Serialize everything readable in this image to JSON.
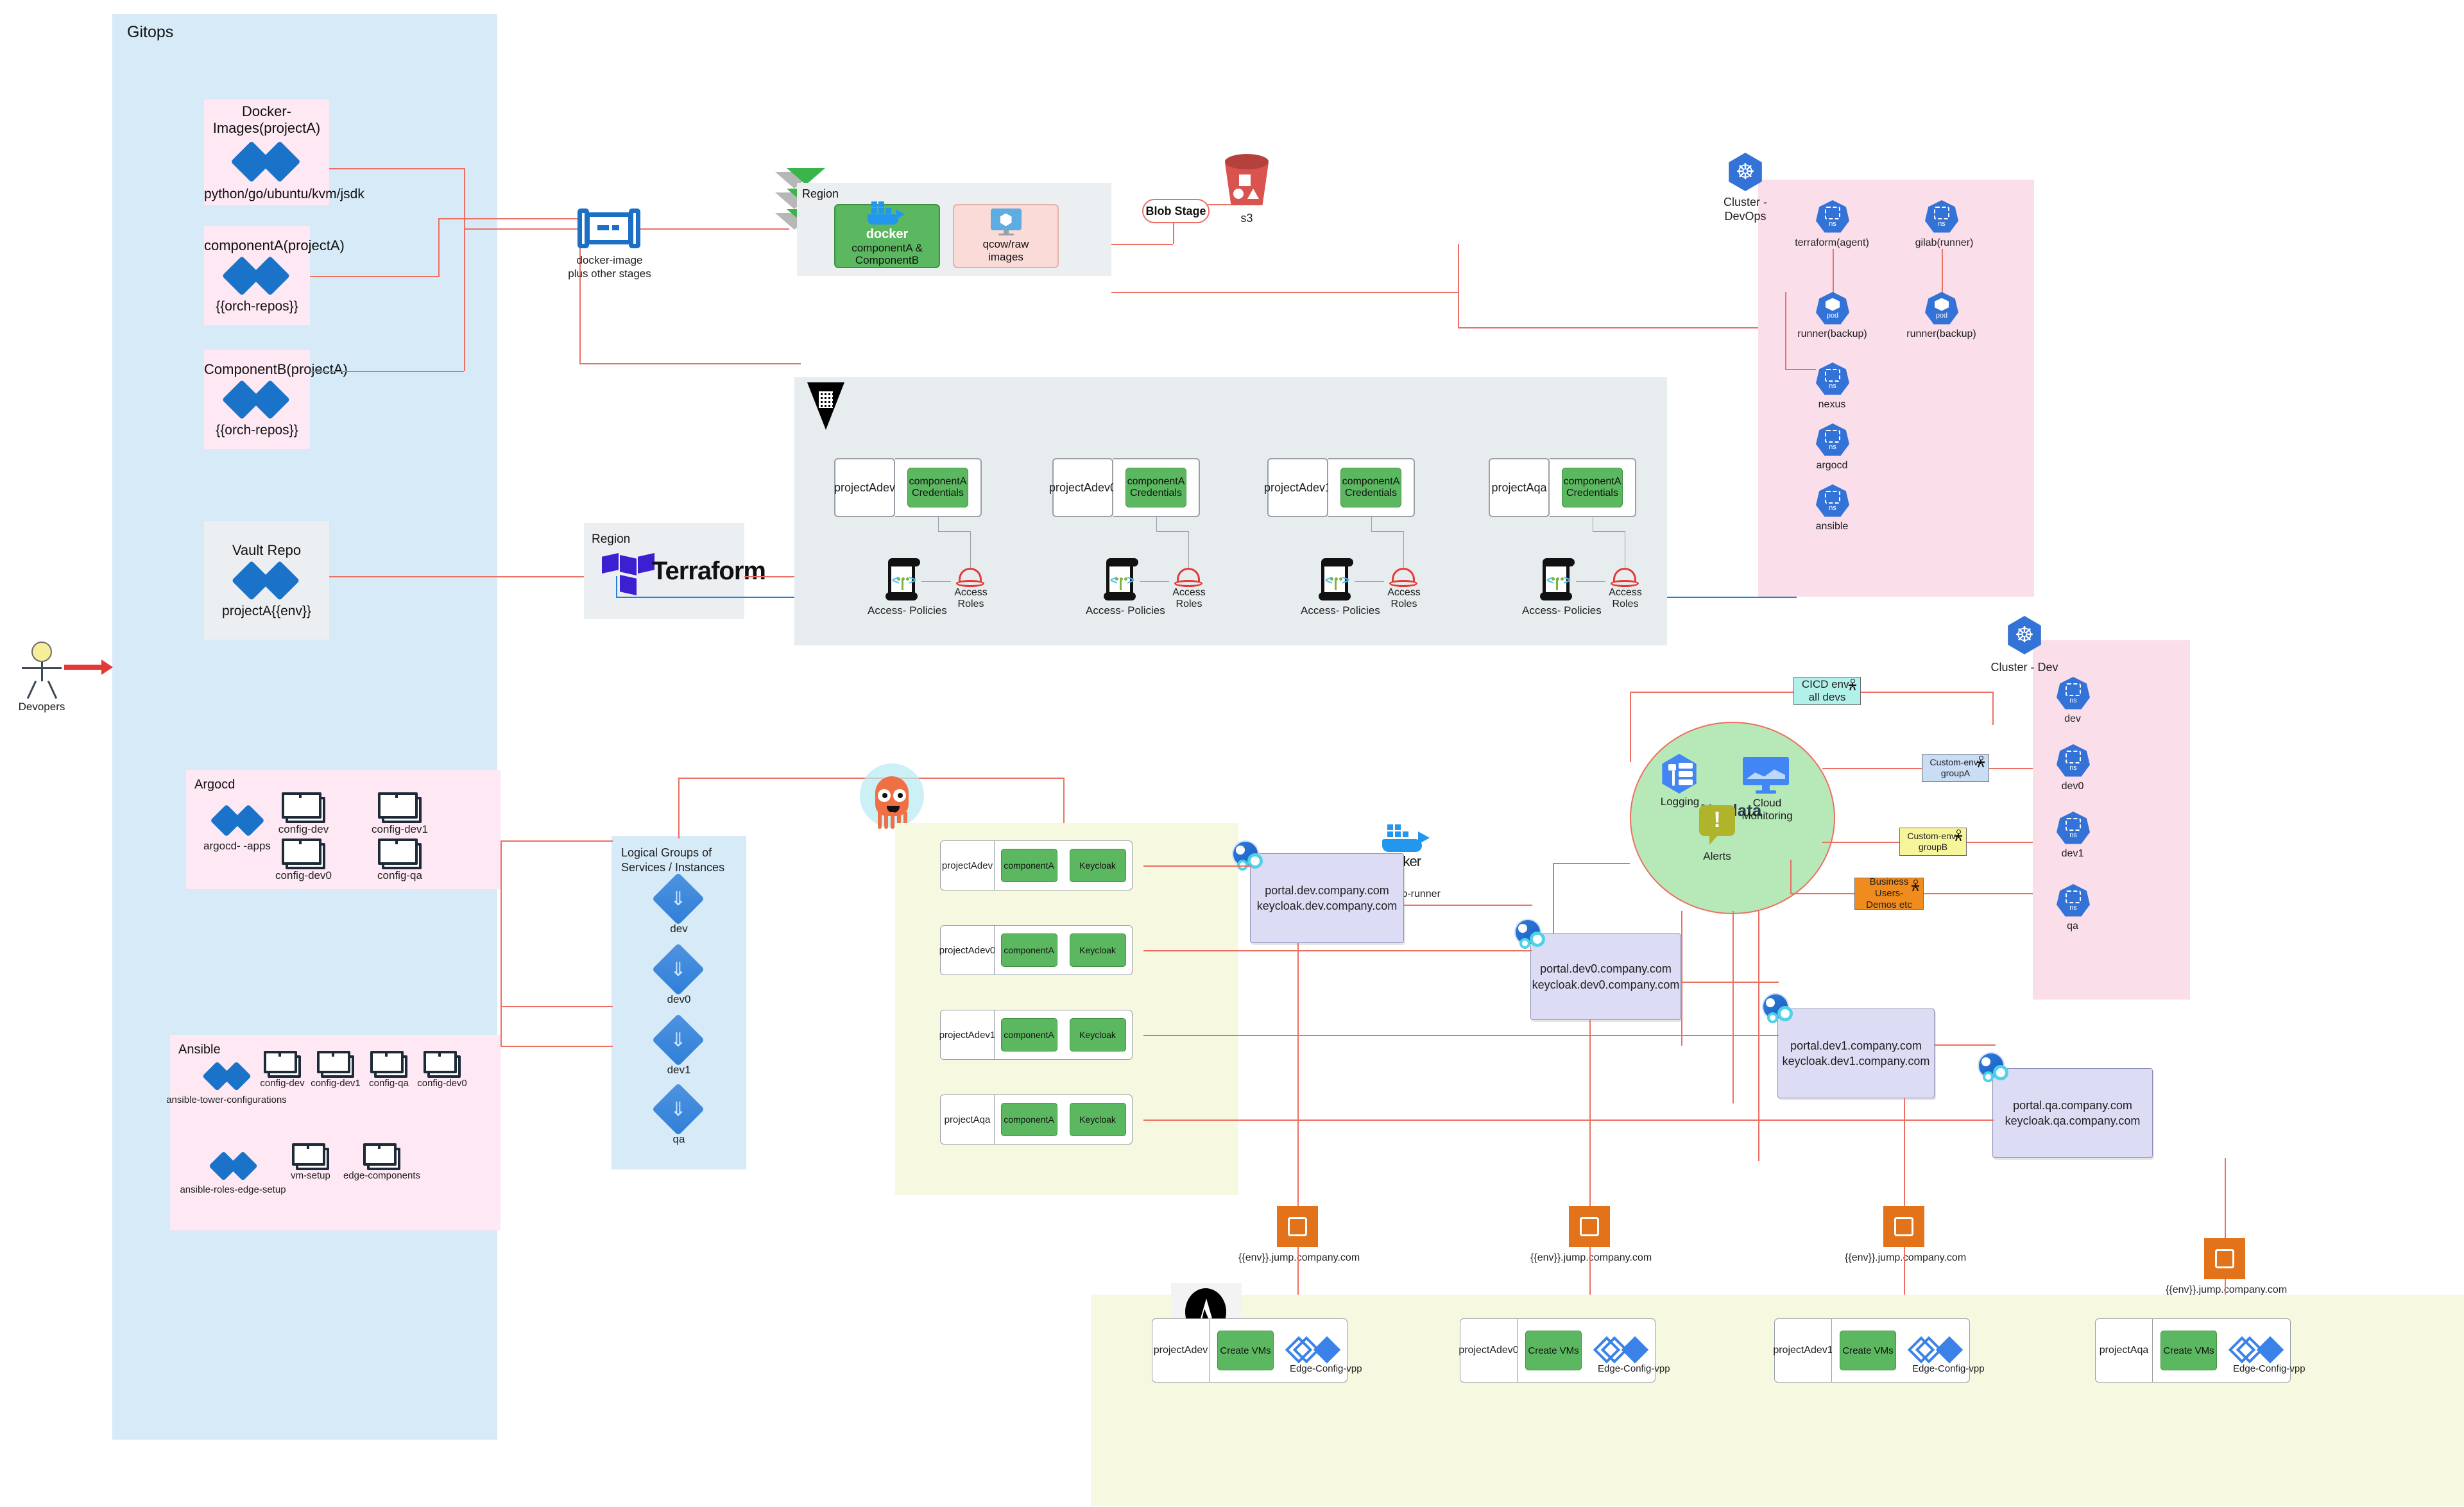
{
  "gitops": {
    "title": "Gitops",
    "repos": [
      {
        "title": "Docker-Images(projectA)",
        "sub": "python/go/ubuntu/kvm/jsdk"
      },
      {
        "title": "componentA(projectA)",
        "sub": "{{orch-repos}}"
      },
      {
        "title": "ComponentB(projectA)",
        "sub": "{{orch-repos}}"
      }
    ],
    "vault": {
      "title": "Vault Repo",
      "sub": "projectA{{env}}"
    },
    "argocd": {
      "label": "Argocd",
      "repo_label": "argocd- -apps",
      "folders": [
        "config-dev",
        "config-dev1",
        "config-dev0",
        "config-qa"
      ]
    },
    "ansible": {
      "label": "Ansible",
      "repo_label_1": "ansible-tower-configurations",
      "repo_label_2": "ansible-roles-edge-setup",
      "folders_1": [
        "config-dev",
        "config-dev1",
        "config-qa",
        "config-dev0"
      ],
      "folders_2": [
        "vm-setup",
        "edge-components"
      ]
    }
  },
  "actor": {
    "label": "Devopers"
  },
  "pipeline": {
    "label_line1": "docker-image",
    "label_line2": "plus other stages"
  },
  "registry_region": {
    "title": "Region",
    "docker_tile": {
      "word": "docker",
      "label_line1": "componentA &",
      "label_line2": "ComponentB"
    },
    "image_tile": {
      "label_line1": "qcow/raw",
      "label_line2": "images"
    }
  },
  "blob": {
    "chip": "Blob Stage",
    "bucket_label": "s3"
  },
  "terraform": {
    "region_label": "Region",
    "word": "Terraform"
  },
  "credentials": {
    "columns": [
      {
        "project": "projectAdev",
        "credential": "componentA\nCredentials",
        "policy": "Access- Policies",
        "roles": "Access Roles"
      },
      {
        "project": "projectAdev0",
        "credential": "componentA\nCredentials",
        "policy": "Access- Policies",
        "roles": "Access Roles"
      },
      {
        "project": "projectAdev1",
        "credential": "componentA\nCredentials",
        "policy": "Access- Policies",
        "roles": "Access Roles"
      },
      {
        "project": "projectAqa",
        "credential": "componentA\nCredentials",
        "policy": "Access- Policies",
        "roles": "Access Roles"
      }
    ]
  },
  "cluster_devops": {
    "title": "Cluster - DevOps",
    "nodes": [
      {
        "kind": "ns",
        "label": "terraform(agent)"
      },
      {
        "kind": "ns",
        "label": "gilab(runner)"
      },
      {
        "kind": "pod",
        "label": "runner(backup)"
      },
      {
        "kind": "pod",
        "label": "runner(backup)"
      },
      {
        "kind": "ns",
        "label": "nexus"
      },
      {
        "kind": "ns",
        "label": "argocd"
      },
      {
        "kind": "ns",
        "label": "ansible"
      }
    ]
  },
  "cluster_dev": {
    "title": "Cluster - Dev",
    "nodes": [
      {
        "kind": "ns",
        "label": "dev"
      },
      {
        "kind": "ns",
        "label": "dev0"
      },
      {
        "kind": "ns",
        "label": "dev1"
      },
      {
        "kind": "ns",
        "label": "qa"
      }
    ]
  },
  "logical_groups": {
    "title": "Logical Groups of Services / Instances",
    "items": [
      "dev",
      "dev0",
      "dev1",
      "qa"
    ]
  },
  "services": {
    "rows": [
      {
        "project": "projectAdev",
        "component": "componentA",
        "auth": "Keycloak"
      },
      {
        "project": "projectAdev0",
        "component": "componentA",
        "auth": "Keycloak"
      },
      {
        "project": "projectAdev1",
        "component": "componentA",
        "auth": "Keycloak"
      },
      {
        "project": "projectAqa",
        "component": "componentA",
        "auth": "Keycloak"
      }
    ]
  },
  "gitlab_runner": {
    "word": "docker",
    "label": "gitlab-runner"
  },
  "portals": [
    {
      "line1": "portal.dev.company.com",
      "line2": "keycloak.dev.company.com"
    },
    {
      "line1": "portal.dev0.company.com",
      "line2": "keycloak.dev0.company.com"
    },
    {
      "line1": "portal.dev1.company.com",
      "line2": "keycloak.dev1.company.com"
    },
    {
      "line1": "portal.qa.company.com",
      "line2": "keycloak.qa.company.com"
    }
  ],
  "netdata": {
    "word": "Netdata",
    "logging_label": "Logging",
    "monitoring_label": "Cloud Monitoring",
    "alerts_label": "Alerts"
  },
  "audience": [
    {
      "label": "CICD env- all devs",
      "color": "#b2f0ea"
    },
    {
      "label": "Custom-env-groupA",
      "color": "#c9ddf5"
    },
    {
      "label": "Custom-env-groupB",
      "color": "#f7f59a"
    },
    {
      "label": "Business Users- Demos etc",
      "color": "#f08c1d"
    }
  ],
  "jump_hosts": [
    {
      "label": "{{env}}.jump.company.com"
    },
    {
      "label": "{{env}}.jump.company.com"
    },
    {
      "label": "{{env}}.jump.company.com"
    },
    {
      "label": "{{env}}.jump.company.com"
    }
  ],
  "ansible_brand": {
    "word": "ANSIB"
  },
  "vm_rows": [
    {
      "project": "projectAdev",
      "action": "Create VMs",
      "edge": "Edge-Config-vpp"
    },
    {
      "project": "projectAdev0",
      "action": "Create VMs",
      "edge": "Edge-Config-vpp"
    },
    {
      "project": "projectAdev1",
      "action": "Create VMs",
      "edge": "Edge-Config-vpp"
    },
    {
      "project": "projectAqa",
      "action": "Create VMs",
      "edge": "Edge-Config-vpp"
    }
  ],
  "colors": {
    "wire": "#ec7063",
    "wire_blue": "#2a7fd4",
    "gitops_bg": "#d6eaf8",
    "repo_bg": "#fde8f3",
    "cluster_bg": "#fadeea",
    "green": "#5cb860",
    "portal_bg": "#dcdcf5",
    "band_bg": "#f7f8e0",
    "netdata_bg": "#b6e8b8"
  }
}
